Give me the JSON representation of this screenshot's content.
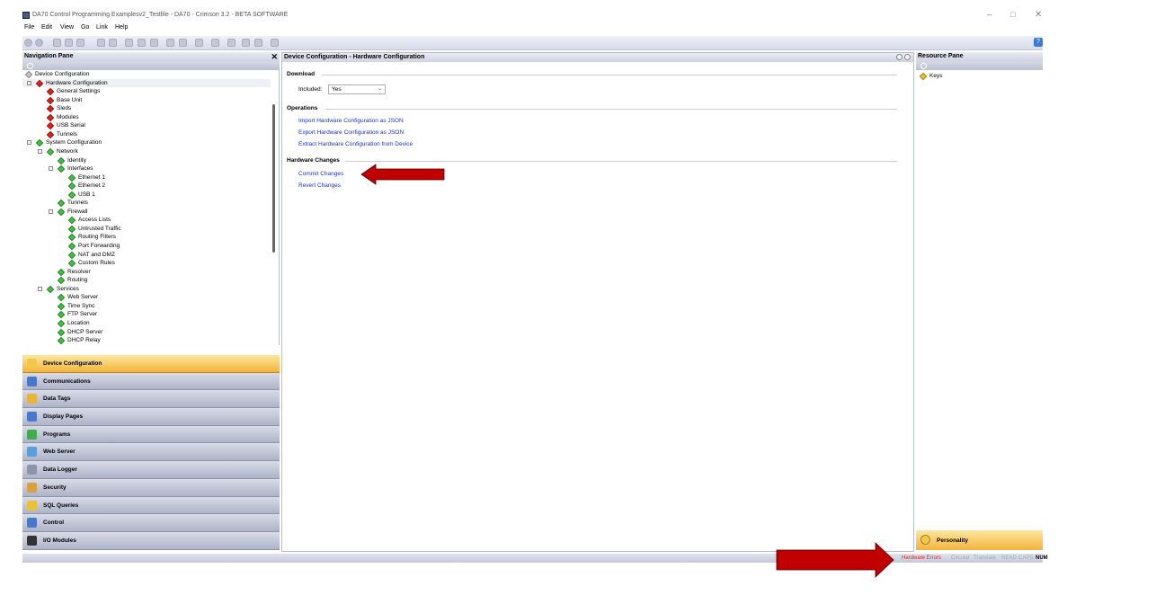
{
  "window": {
    "title": "DA70 Control Programming Examplesv2_Testfile - DA70 - Crimson 3.2 - BETA SOFTWARE",
    "controls": [
      "–",
      "□",
      "✕"
    ]
  },
  "menu": [
    "File",
    "Edit",
    "View",
    "Go",
    "Link",
    "Help"
  ],
  "toolbar": {
    "help_label": "?"
  },
  "navigation": {
    "title": "Navigation Pane",
    "close_glyph": "✕",
    "tree": [
      {
        "label": "Device Configuration",
        "level": 0,
        "icon": "gray"
      },
      {
        "label": "Hardware Configuration",
        "level": 1,
        "icon": "red",
        "expander": "⊟",
        "selected": true
      },
      {
        "label": "General Settings",
        "level": 2,
        "icon": "red"
      },
      {
        "label": "Base Unit",
        "level": 2,
        "icon": "red"
      },
      {
        "label": "Sleds",
        "level": 2,
        "icon": "red"
      },
      {
        "label": "Modules",
        "level": 2,
        "icon": "red"
      },
      {
        "label": "USB Serial",
        "level": 2,
        "icon": "red"
      },
      {
        "label": "Tunnels",
        "level": 2,
        "icon": "red"
      },
      {
        "label": "System Configuration",
        "level": 1,
        "icon": "green",
        "expander": "⊟"
      },
      {
        "label": "Network",
        "level": 2,
        "icon": "green",
        "expander": "⊟"
      },
      {
        "label": "Identity",
        "level": 3,
        "icon": "green"
      },
      {
        "label": "Interfaces",
        "level": 3,
        "icon": "green",
        "expander": "⊟"
      },
      {
        "label": "Ethernet 1",
        "level": 4,
        "icon": "green"
      },
      {
        "label": "Ethernet 2",
        "level": 4,
        "icon": "green"
      },
      {
        "label": "USB 1",
        "level": 4,
        "icon": "green"
      },
      {
        "label": "Tunnels",
        "level": 3,
        "icon": "green"
      },
      {
        "label": "Firewall",
        "level": 3,
        "icon": "green",
        "expander": "⊟"
      },
      {
        "label": "Access Lists",
        "level": 4,
        "icon": "green"
      },
      {
        "label": "Untrusted Traffic",
        "level": 4,
        "icon": "green"
      },
      {
        "label": "Routing Filters",
        "level": 4,
        "icon": "green"
      },
      {
        "label": "Port Forwarding",
        "level": 4,
        "icon": "green"
      },
      {
        "label": "NAT and DMZ",
        "level": 4,
        "icon": "green"
      },
      {
        "label": "Custom Rules",
        "level": 4,
        "icon": "green"
      },
      {
        "label": "Resolver",
        "level": 3,
        "icon": "green"
      },
      {
        "label": "Routing",
        "level": 3,
        "icon": "green"
      },
      {
        "label": "Services",
        "level": 2,
        "icon": "green",
        "expander": "⊟"
      },
      {
        "label": "Web Server",
        "level": 3,
        "icon": "green"
      },
      {
        "label": "Time Sync",
        "level": 3,
        "icon": "green"
      },
      {
        "label": "FTP Server",
        "level": 3,
        "icon": "green"
      },
      {
        "label": "Location",
        "level": 3,
        "icon": "green"
      },
      {
        "label": "DHCP Server",
        "level": 3,
        "icon": "green"
      },
      {
        "label": "DHCP Relay",
        "level": 3,
        "icon": "green"
      }
    ],
    "categories": [
      {
        "label": "Device Configuration",
        "icon": "device-config-icon",
        "color": "#f2c84b",
        "active": true
      },
      {
        "label": "Communications",
        "icon": "communications-icon",
        "color": "#4a78c8"
      },
      {
        "label": "Data Tags",
        "icon": "data-tags-icon",
        "color": "#e8b43a"
      },
      {
        "label": "Display Pages",
        "icon": "display-pages-icon",
        "color": "#4a78c8"
      },
      {
        "label": "Programs",
        "icon": "programs-icon",
        "color": "#3fae4a"
      },
      {
        "label": "Web Server",
        "icon": "web-server-icon",
        "color": "#5aa0d8"
      },
      {
        "label": "Data Logger",
        "icon": "data-logger-icon",
        "color": "#8d96a8"
      },
      {
        "label": "Security",
        "icon": "security-icon",
        "color": "#d8a040"
      },
      {
        "label": "SQL Queries",
        "icon": "sql-queries-icon",
        "color": "#e8c23a"
      },
      {
        "label": "Control",
        "icon": "control-icon",
        "color": "#4a78c8"
      },
      {
        "label": "I/O Modules",
        "icon": "io-modules-icon",
        "color": "#333333"
      }
    ]
  },
  "main": {
    "title": "Device Configuration - Hardware Configuration",
    "download": {
      "header": "Download",
      "included_label": "Included:",
      "included_value": "Yes",
      "dropdown_glyph": "⌄"
    },
    "operations": {
      "header": "Operations",
      "links": [
        "Import Hardware Configuration as JSON",
        "Export Hardware Configuration as JSON",
        "Extract Hardware Configuration from Device"
      ]
    },
    "hardware_changes": {
      "header": "Hardware Changes",
      "links": [
        "Commit Changes",
        "Revert Changes"
      ]
    }
  },
  "resource": {
    "title": "Resource Pane",
    "items": [
      {
        "label": "Keys",
        "icon": "yellow"
      }
    ],
    "personality_label": "Personality"
  },
  "status": {
    "hardware_errors": "Hardware Errors",
    "circular": "Circular",
    "translate": "Translate",
    "read": "READ",
    "caps": "CAPS",
    "num": "NUM",
    "error_color": "#e0201d",
    "dim_color": "#a0a6b8"
  },
  "annotations": {
    "arrow_color": "#c00000"
  }
}
